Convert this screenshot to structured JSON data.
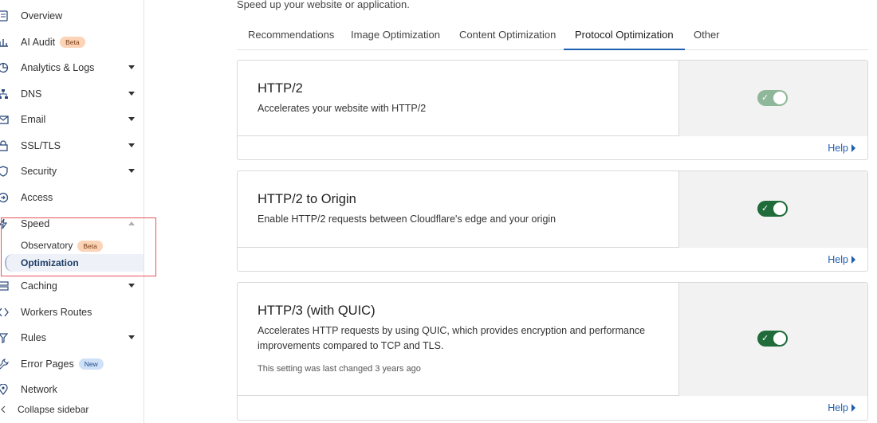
{
  "sidebar": {
    "items": [
      {
        "label": "Overview",
        "icon": "document-icon"
      },
      {
        "label": "AI Audit",
        "icon": "ai-audit-icon",
        "badge": "Beta"
      },
      {
        "label": "Analytics & Logs",
        "icon": "analytics-icon"
      },
      {
        "label": "DNS",
        "icon": "dns-icon"
      },
      {
        "label": "Email",
        "icon": "email-icon"
      },
      {
        "label": "SSL/TLS",
        "icon": "lock-icon"
      },
      {
        "label": "Security",
        "icon": "shield-icon"
      },
      {
        "label": "Access",
        "icon": "access-icon"
      },
      {
        "label": "Speed",
        "icon": "lightning-icon"
      },
      {
        "label": "Caching",
        "icon": "caching-icon"
      },
      {
        "label": "Workers Routes",
        "icon": "workers-icon"
      },
      {
        "label": "Rules",
        "icon": "rules-icon"
      },
      {
        "label": "Error Pages",
        "icon": "wrench-icon",
        "badge": "New"
      },
      {
        "label": "Network",
        "icon": "location-icon"
      }
    ],
    "speed_sub": {
      "observatory": "Observatory",
      "observatory_badge": "Beta",
      "optimization": "Optimization"
    },
    "collapse_label": "Collapse sidebar"
  },
  "main": {
    "subtitle": "Speed up your website or application.",
    "tabs": [
      "Recommendations",
      "Image Optimization",
      "Content Optimization",
      "Protocol Optimization",
      "Other"
    ],
    "active_tab": "Protocol Optimization",
    "cards": [
      {
        "title": "HTTP/2",
        "description": "Accelerates your website with HTTP/2",
        "toggle_on": true,
        "toggle_disabled": true,
        "help": "Help"
      },
      {
        "title": "HTTP/2 to Origin",
        "description": "Enable HTTP/2 requests between Cloudflare's edge and your origin",
        "toggle_on": true,
        "toggle_disabled": false,
        "help": "Help"
      },
      {
        "title": "HTTP/3 (with QUIC)",
        "description": "Accelerates HTTP requests by using QUIC, which provides encryption and performance improvements compared to TCP and TLS.",
        "meta": "This setting was last changed 3 years ago",
        "toggle_on": true,
        "toggle_disabled": false,
        "help": "Help"
      }
    ]
  },
  "colors": {
    "accent": "#1f5fb0",
    "toggle_on": "#1f6b3a",
    "toggle_disabled": "#8fb79a",
    "highlight": "#e5545c"
  }
}
